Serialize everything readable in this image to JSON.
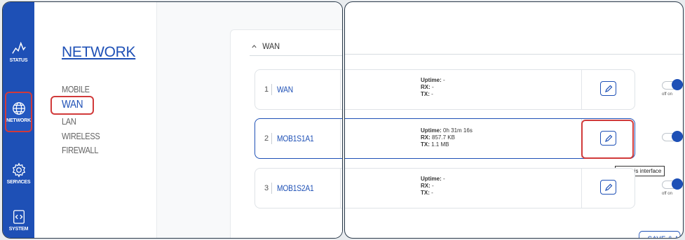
{
  "sidebar": {
    "items": [
      {
        "label": "STATUS",
        "icon": "activity-icon"
      },
      {
        "label": "NETWORK",
        "icon": "globe-icon"
      },
      {
        "label": "SERVICES",
        "icon": "gear-icon"
      },
      {
        "label": "SYSTEM",
        "icon": "code-file-icon"
      }
    ]
  },
  "menu": {
    "title": "NETWORK",
    "items": [
      "MOBILE",
      "WAN",
      "LAN",
      "WIRELESS",
      "FIREWALL"
    ]
  },
  "section": {
    "title": "WAN"
  },
  "interfaces": [
    {
      "num": "1",
      "name": "WAN",
      "uptime_label": "Uptime:",
      "uptime": "-",
      "rx_label": "RX:",
      "rx": "-",
      "tx_label": "TX:",
      "tx": "-"
    },
    {
      "num": "2",
      "name": "MOB1S1A1",
      "uptime_label": "Uptime:",
      "uptime": "0h 31m 16s",
      "rx_label": "RX:",
      "rx": "857.7 KB",
      "tx_label": "TX:",
      "tx": "1.1 MB"
    },
    {
      "num": "3",
      "name": "MOB1S2A1",
      "uptime_label": "Uptime:",
      "uptime": "-",
      "rx_label": "RX:",
      "rx": "-",
      "tx_label": "TX:",
      "tx": "-"
    }
  ],
  "toggle": {
    "off": "off",
    "on": "on"
  },
  "tooltip": "Edit this interface",
  "save_label": "SAVE & A",
  "colors": {
    "brand": "#1e50b6",
    "highlight": "#d13a3a"
  }
}
